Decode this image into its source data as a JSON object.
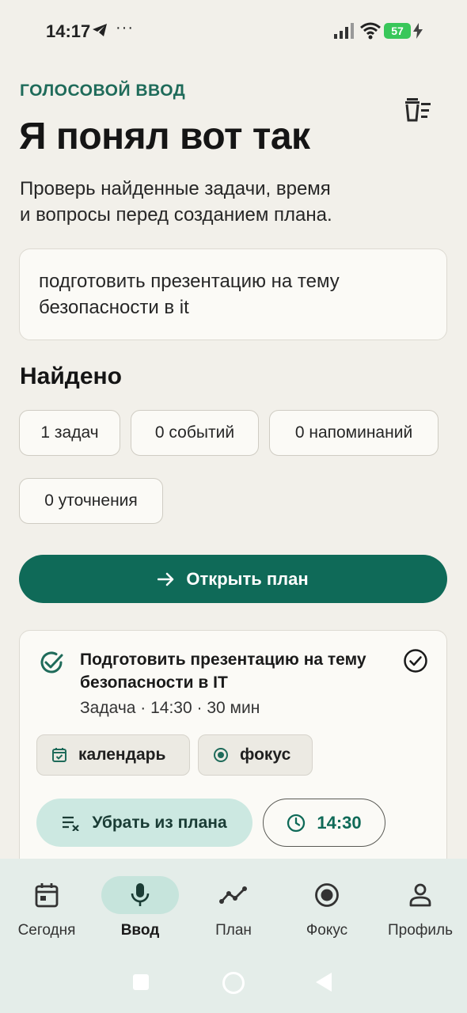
{
  "status_bar": {
    "time": "14:17",
    "dots": "···",
    "battery": "57"
  },
  "header": {
    "eyebrow": "ГОЛОСОВОЙ ВВОД",
    "title": "Я понял вот так",
    "subtitle_line1": "Проверь найденные задачи, время",
    "subtitle_line2": "и вопросы перед созданием плана."
  },
  "transcript": {
    "line1": "подготовить презентацию на тему",
    "line2": "безопасности в it"
  },
  "found": {
    "heading": "Найдено",
    "tasks": "1 задач",
    "events": "0 событий",
    "reminders": "0 напоминаний",
    "clarifications": "0 уточнения"
  },
  "open_plan": {
    "label": "Открыть план"
  },
  "task": {
    "title_line1": "Подготовить презентацию на тему",
    "title_line2": "безопасности в IT",
    "meta": "Задача · 14:30 · 30 мин",
    "tag_calendar": "календарь",
    "tag_focus": "фокус",
    "remove_label": "Убрать из плана",
    "time_label": "14:30"
  },
  "nav": {
    "items": [
      {
        "label": "Сегодня",
        "icon": "calendar-icon"
      },
      {
        "label": "Ввод",
        "icon": "mic-icon"
      },
      {
        "label": "План",
        "icon": "trend-icon"
      },
      {
        "label": "Фокус",
        "icon": "target-icon"
      },
      {
        "label": "Профиль",
        "icon": "person-icon"
      }
    ],
    "active": "Ввод"
  },
  "colors": {
    "accent": "#0f6a58",
    "eyebrow": "#1f6b5a",
    "background": "#f2f0ea",
    "nav_bg": "#e4ede9",
    "active_pill": "#c6e4dc",
    "remove_btn": "#cce8e1"
  }
}
